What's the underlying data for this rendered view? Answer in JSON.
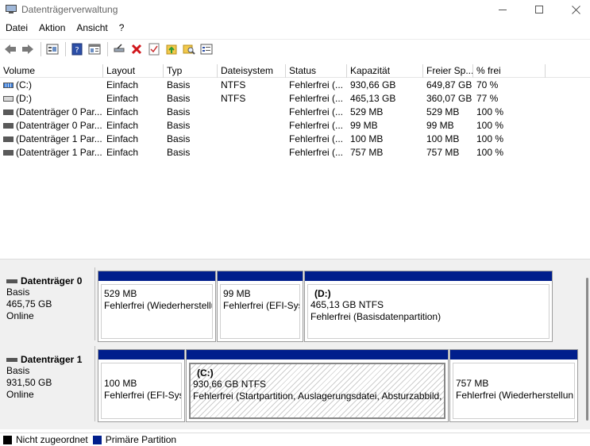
{
  "window": {
    "title": "Datenträgerverwaltung",
    "controls": {
      "minimize": "—",
      "maximize": "☐",
      "close": "✕"
    }
  },
  "menu": [
    "Datei",
    "Aktion",
    "Ansicht",
    "?"
  ],
  "toolbar": {
    "icons": [
      "back-icon",
      "forward-icon",
      "disk-list-icon",
      "help-icon",
      "properties-icon",
      "connect-icon",
      "delete-icon",
      "check-icon",
      "folder-up-icon",
      "folder-search-icon",
      "console-icon"
    ]
  },
  "volume_table": {
    "columns": [
      "Volume",
      "Layout",
      "Typ",
      "Dateisystem",
      "Status",
      "Kapazität",
      "Freier Sp...",
      "% frei"
    ],
    "rows": [
      {
        "volume": "(C:)",
        "layout": "Einfach",
        "typ": "Basis",
        "fs": "NTFS",
        "status": "Fehlerfrei (...",
        "kap": "930,66 GB",
        "frei": "649,87 GB",
        "pct": "70 %",
        "icon": "stripe"
      },
      {
        "volume": "(D:)",
        "layout": "Einfach",
        "typ": "Basis",
        "fs": "NTFS",
        "status": "Fehlerfrei (...",
        "kap": "465,13 GB",
        "frei": "360,07 GB",
        "pct": "77 %",
        "icon": "plain"
      },
      {
        "volume": "(Datenträger 0 Par...",
        "layout": "Einfach",
        "typ": "Basis",
        "fs": "",
        "status": "Fehlerfrei (...",
        "kap": "529 MB",
        "frei": "529 MB",
        "pct": "100 %",
        "icon": "dark"
      },
      {
        "volume": "(Datenträger 0 Par...",
        "layout": "Einfach",
        "typ": "Basis",
        "fs": "",
        "status": "Fehlerfrei (...",
        "kap": "99 MB",
        "frei": "99 MB",
        "pct": "100 %",
        "icon": "dark"
      },
      {
        "volume": "(Datenträger 1 Par...",
        "layout": "Einfach",
        "typ": "Basis",
        "fs": "",
        "status": "Fehlerfrei (...",
        "kap": "100 MB",
        "frei": "100 MB",
        "pct": "100 %",
        "icon": "dark"
      },
      {
        "volume": "(Datenträger 1 Par...",
        "layout": "Einfach",
        "typ": "Basis",
        "fs": "",
        "status": "Fehlerfrei (...",
        "kap": "757 MB",
        "frei": "757 MB",
        "pct": "100 %",
        "icon": "dark"
      }
    ]
  },
  "disks": [
    {
      "name": "Datenträger 0",
      "type": "Basis",
      "size": "465,75 GB",
      "state": "Online",
      "partitions": [
        {
          "name": "",
          "size": "529 MB",
          "status": "Fehlerfrei (Wiederherstellu"
        },
        {
          "name": "",
          "size": "99 MB",
          "status": "Fehlerfrei (EFI-Sys"
        },
        {
          "name": "(D:)",
          "size": "465,13 GB NTFS",
          "status": "Fehlerfrei (Basisdatenpartition)"
        }
      ]
    },
    {
      "name": "Datenträger 1",
      "type": "Basis",
      "size": "931,50 GB",
      "state": "Online",
      "partitions": [
        {
          "name": "",
          "size": "100 MB",
          "status": "Fehlerfrei (EFI-Syst"
        },
        {
          "name": "(C:)",
          "size": "930,66 GB NTFS",
          "status": "Fehlerfrei (Startpartition, Auslagerungsdatei, Absturzabbild, I"
        },
        {
          "name": "",
          "size": "757 MB",
          "status": "Fehlerfrei (Wiederherstellun"
        }
      ]
    }
  ],
  "legend": [
    {
      "label": "Nicht zugeordnet",
      "color": "#000000"
    },
    {
      "label": "Primäre Partition",
      "color": "#001e8c"
    }
  ]
}
